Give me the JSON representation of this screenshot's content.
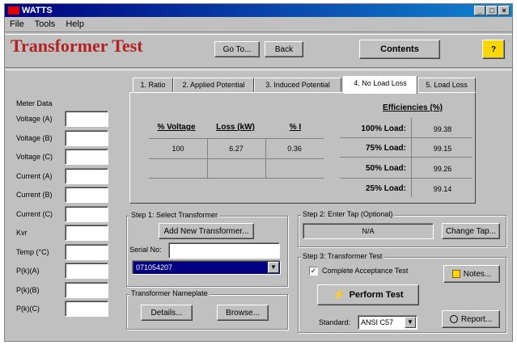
{
  "window": {
    "title": "WATTS"
  },
  "menu": {
    "file": "File",
    "tools": "Tools",
    "help": "Help"
  },
  "app_title": "Transformer Test",
  "toolbar": {
    "goto": "Go To...",
    "back": "Back",
    "contents": "Contents",
    "help_icon": "?"
  },
  "meter": {
    "title": "Meter Data",
    "fields": [
      {
        "label": "Voltage (A)",
        "value": ""
      },
      {
        "label": "Voltage (B)",
        "value": ""
      },
      {
        "label": "Voltage (C)",
        "value": ""
      },
      {
        "label": "Current (A)",
        "value": ""
      },
      {
        "label": "Current (B)",
        "value": ""
      },
      {
        "label": "Current (C)",
        "value": ""
      },
      {
        "label": "Kvr",
        "value": ""
      },
      {
        "label": "Temp (°C)",
        "value": ""
      },
      {
        "label": "P(k)(A)",
        "value": ""
      },
      {
        "label": "P(k)(B)",
        "value": ""
      },
      {
        "label": "P(k)(C)",
        "value": ""
      }
    ]
  },
  "tabs": [
    "1. Ratio",
    "2. Applied Potential",
    "3. Induced Potential",
    "4. No Load Loss",
    "5. Load Loss"
  ],
  "active_tab": 3,
  "noload": {
    "headers": [
      "% Voltage",
      "Loss (kW)",
      "% I"
    ],
    "row": [
      "100",
      "6.27",
      "0.36"
    ]
  },
  "efficiencies": {
    "title": "Efficiencies (%)",
    "items": [
      {
        "label": "100% Load:",
        "value": "99.38"
      },
      {
        "label": "75% Load:",
        "value": "99.15"
      },
      {
        "label": "50% Load:",
        "value": "99.26"
      },
      {
        "label": "25% Load:",
        "value": "99.14"
      }
    ]
  },
  "step1": {
    "title": "Step 1: Select Transformer",
    "add_button": "Add New Transformer...",
    "serial_label": "Serial No:",
    "serial_value": "",
    "selected": "071054207"
  },
  "nameplate": {
    "title": "Transformer Nameplate",
    "details": "Details...",
    "browse": "Browse..."
  },
  "step2": {
    "title": "Step 2: Enter Tap (Optional)",
    "tap_value": "N/A",
    "change_tap": "Change Tap..."
  },
  "step3": {
    "title": "Step 3: Transformer Test",
    "complete_label": "Complete Acceptance Test",
    "checked": true,
    "notes": "Notes...",
    "perform": "Perform Test",
    "standard_label": "Standard:",
    "standard_value": "ANSI C57",
    "report": "Report..."
  }
}
